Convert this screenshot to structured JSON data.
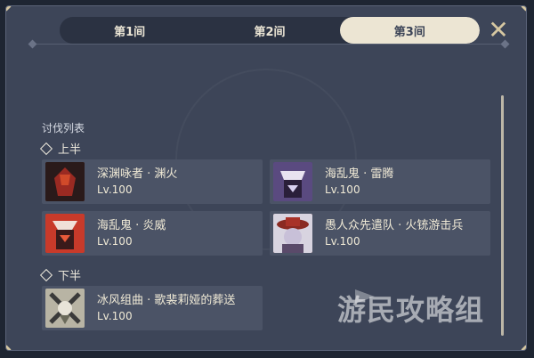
{
  "tabs": [
    {
      "label": "第1间",
      "active": false
    },
    {
      "label": "第2间",
      "active": false
    },
    {
      "label": "第3间",
      "active": true
    }
  ],
  "list_title": "讨伐列表",
  "sections": {
    "upper": {
      "label": "上半",
      "enemies": [
        {
          "name": "深渊咏者 · 渊火",
          "level": "Lv.100",
          "portrait_icon": "abyss-lector-fathomless-flames-icon",
          "color": "#6b2b22"
        },
        {
          "name": "海乱鬼 · 雷腾",
          "level": "Lv.100",
          "portrait_icon": "kairagi-thunderbolt-icon",
          "color": "#4a3a66"
        },
        {
          "name": "海乱鬼 · 炎威",
          "level": "Lv.100",
          "portrait_icon": "kairagi-fiery-might-icon",
          "color": "#8a2222"
        },
        {
          "name": "愚人众先遣队 · 火铳游击兵",
          "level": "Lv.100",
          "portrait_icon": "fatui-pyro-agent-icon",
          "color": "#7a2a22"
        }
      ]
    },
    "lower": {
      "label": "下半",
      "enemies": [
        {
          "name": "冰风组曲 · 歌裴莉娅的葬送",
          "level": "Lv.100",
          "portrait_icon": "icewind-suite-coppelia-icon",
          "color": "#8a8a78"
        }
      ]
    }
  },
  "watermark": "游民攻略组",
  "colors": {
    "panel": "#3d4558",
    "card": "#4b5366",
    "accent": "#d6c7a1",
    "active_tab": "#ece5d3"
  }
}
